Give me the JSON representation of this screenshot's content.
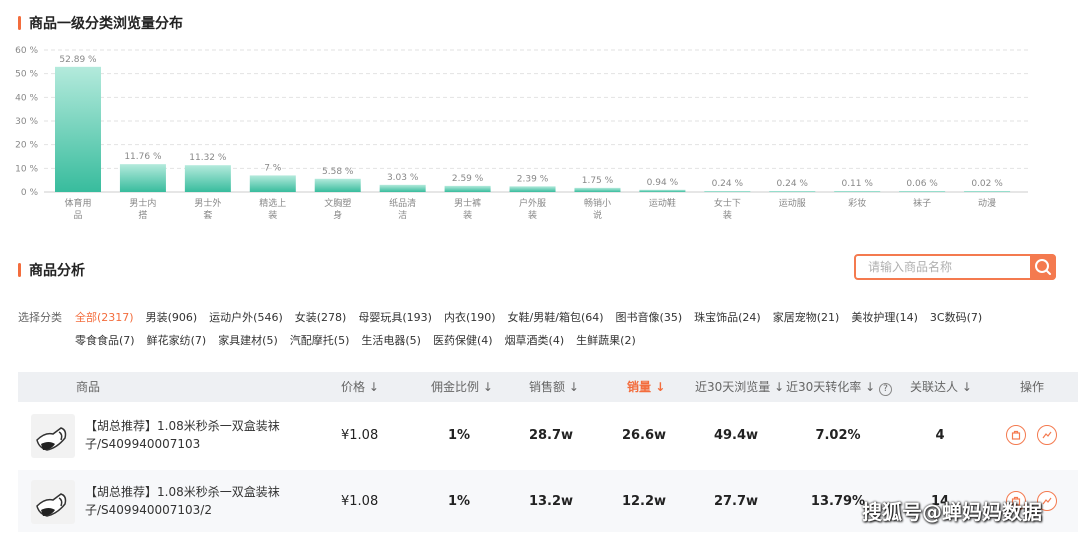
{
  "chart_section": {
    "title": "商品一级分类浏览量分布"
  },
  "chart_data": {
    "type": "bar",
    "title": "商品一级分类浏览量分布",
    "categories": [
      "体育用品",
      "男士内搭",
      "男士外套",
      "精选上装",
      "文胸塑身",
      "纸品清洁",
      "男士裤装",
      "户外服装",
      "畅销小说",
      "运动鞋",
      "女士下装",
      "运动服",
      "彩妆",
      "袜子",
      "动漫"
    ],
    "category_lines": [
      [
        "体育用",
        "品"
      ],
      [
        "男士内",
        "搭"
      ],
      [
        "男士外",
        "套"
      ],
      [
        "精选上",
        "装"
      ],
      [
        "文胸塑",
        "身"
      ],
      [
        "纸品清",
        "洁"
      ],
      [
        "男士裤",
        "装"
      ],
      [
        "户外服",
        "装"
      ],
      [
        "畅销小",
        "说"
      ],
      [
        "运动鞋"
      ],
      [
        "女士下",
        "装"
      ],
      [
        "运动服"
      ],
      [
        "彩妆"
      ],
      [
        "袜子"
      ],
      [
        "动漫"
      ]
    ],
    "values": [
      52.89,
      11.76,
      11.32,
      7,
      5.58,
      3.03,
      2.59,
      2.39,
      1.75,
      0.94,
      0.24,
      0.24,
      0.11,
      0.06,
      0.02
    ],
    "value_labels": [
      "52.89 %",
      "11.76 %",
      "11.32 %",
      "7 %",
      "5.58 %",
      "3.03 %",
      "2.59 %",
      "2.39 %",
      "1.75 %",
      "0.94 %",
      "0.24 %",
      "0.24 %",
      "0.11 %",
      "0.06 %",
      "0.02 %"
    ],
    "yticks": [
      "60 %",
      "50 %",
      "40 %",
      "30 %",
      "20 %",
      "10 %",
      "0 %"
    ],
    "ylim": [
      0,
      60
    ],
    "grid": true,
    "bar_color_top": "#a8e6d6",
    "bar_color_bottom": "#3ec0a2"
  },
  "analysis_section": {
    "title": "商品分析"
  },
  "search": {
    "placeholder": "请输入商品名称"
  },
  "filter_label": "选择分类",
  "filters_row1": [
    "全部(2317)",
    "男装(906)",
    "运动户外(546)",
    "女装(278)",
    "母婴玩具(193)",
    "内衣(190)",
    "女鞋/男鞋/箱包(64)",
    "图书音像(35)",
    "珠宝饰品(24)",
    "家居宠物(21)",
    "美妆护理(14)",
    "3C数码(7)"
  ],
  "filters_row2": [
    "零食食品(7)",
    "鲜花家纺(7)",
    "家具建材(5)",
    "汽配摩托(5)",
    "生活电器(5)",
    "医药保健(4)",
    "烟草酒类(4)",
    "生鲜蔬果(2)"
  ],
  "table": {
    "headers": {
      "product": "商品",
      "price": "价格",
      "commission": "佣金比例",
      "sales_amount": "销售额",
      "sales_volume": "销量",
      "views30": "近30天浏览量",
      "conv30": "近30天转化率",
      "influencers": "关联达人",
      "ops": "操作"
    },
    "rows": [
      {
        "name": "【胡总推荐】1.08米秒杀一双盒装袜子/S409940007103",
        "price": "¥1.08",
        "commission": "1%",
        "sales_amount": "28.7w",
        "sales_volume": "26.6w",
        "views30": "49.4w",
        "conv30": "7.02%",
        "influencers": "4"
      },
      {
        "name": "【胡总推荐】1.08米秒杀一双盒装袜子/S409940007103/2",
        "price": "¥1.08",
        "commission": "1%",
        "sales_amount": "13.2w",
        "sales_volume": "12.2w",
        "views30": "27.7w",
        "conv30": "13.79%",
        "influencers": "14"
      }
    ]
  },
  "watermark": "搜狐号@蝉妈妈数据",
  "colors": {
    "accent": "#f36d3d",
    "bar": "#3ec0a2",
    "header_bg": "#eef0f3"
  }
}
